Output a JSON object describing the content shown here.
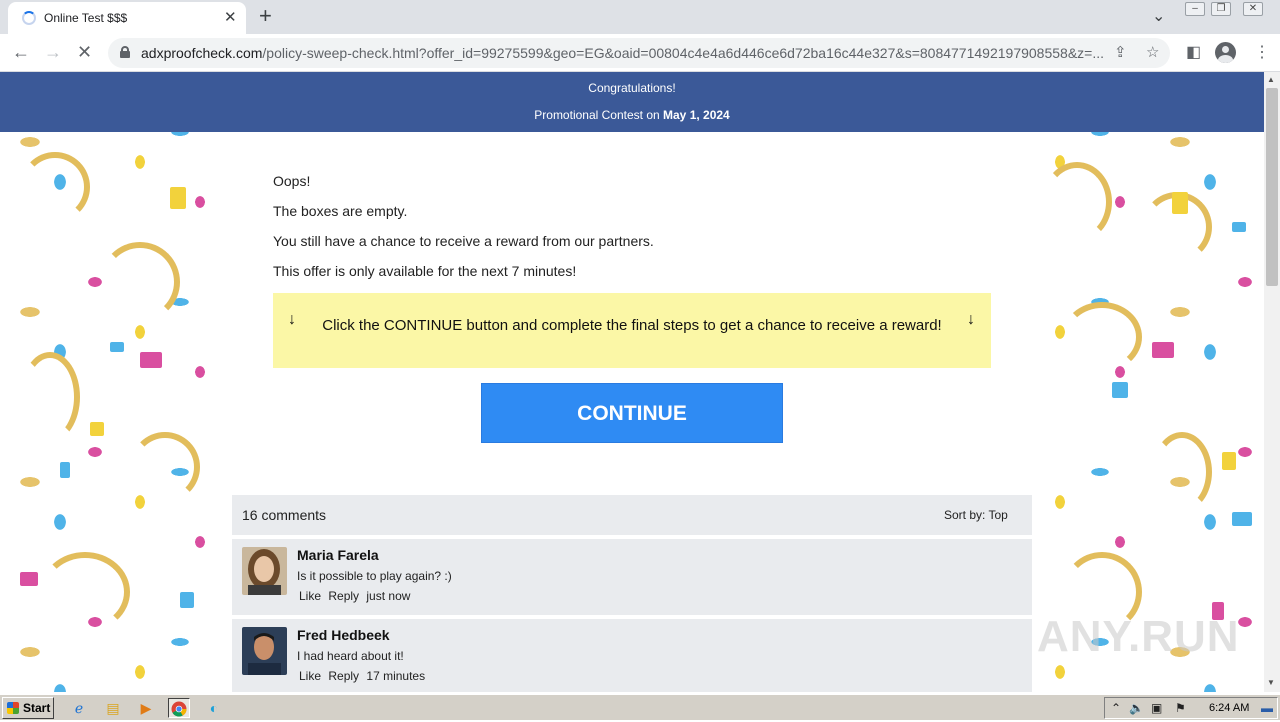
{
  "browser": {
    "tab_title": "Online Test $$$",
    "url_host": "adxproofcheck.com",
    "url_path": "/policy-sweep-check.html?offer_id=99275599&geo=EG&oaid=00804c4e4a6d446ce6d72ba16c44e327&s=8084771492197908558&z=..."
  },
  "header": {
    "line1": "Congratulations!",
    "line2_prefix": "Promotional Contest on",
    "line2_date": "May 1, 2024"
  },
  "content": {
    "p1": "Oops!",
    "p2": "The boxes are empty.",
    "p3": "You still have a chance to receive a reward from our partners.",
    "p4": "This offer is only available for the next 7 minutes!",
    "notice": "Click the CONTINUE button and complete the final steps to get a chance to receive a reward!",
    "arrow": "↓",
    "continue_label": "CONTINUE"
  },
  "comments": {
    "count_label": "16 comments",
    "sort_label": "Sort by:",
    "sort_value": "Top",
    "items": [
      {
        "name": "Maria Farela",
        "text": "Is it possible to play again? :)",
        "like": "Like",
        "reply": "Reply",
        "time": "just now"
      },
      {
        "name": "Fred Hedbeek",
        "text": "I had heard about it!",
        "like": "Like",
        "reply": "Reply",
        "time": "17 minutes"
      }
    ]
  },
  "watermark": "ANY.RUN",
  "taskbar": {
    "start_label": "Start",
    "clock": "6:24 AM"
  },
  "colors": {
    "header_bg": "#3b5998",
    "notice_bg": "#fbf7a6",
    "continue_bg": "#2f8bf3"
  }
}
